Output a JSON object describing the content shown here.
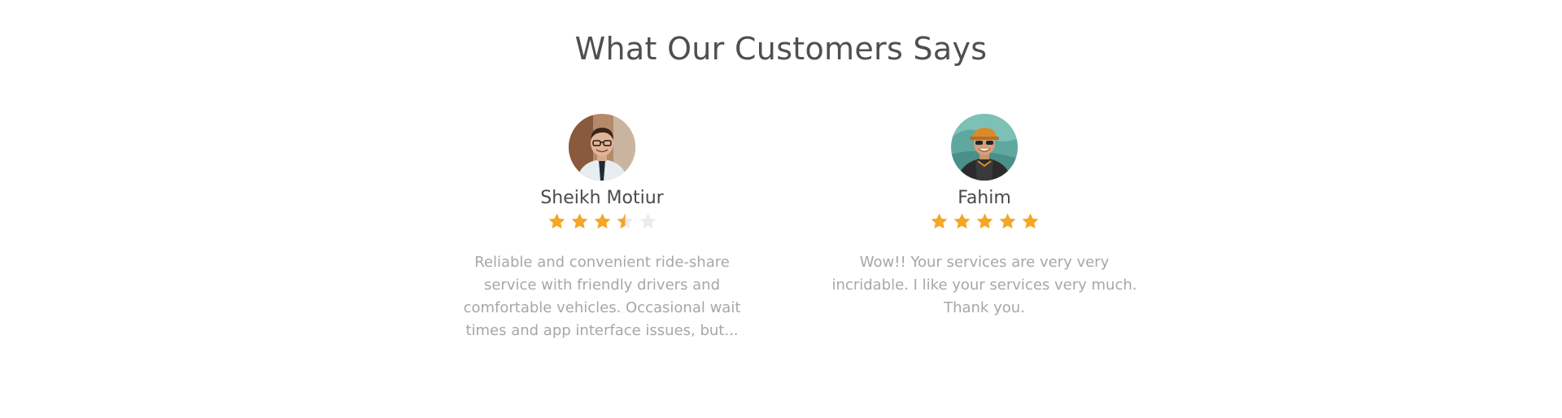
{
  "section": {
    "title": "What Our Customers Says"
  },
  "testimonials": [
    {
      "name": "Sheikh Motiur",
      "rating": 3.5,
      "rating_max": 5,
      "review": "Reliable and convenient ride-share service with friendly drivers and comfortable vehicles. Occasional wait times and app interface issues, but..."
    },
    {
      "name": "Fahim",
      "rating": 5,
      "rating_max": 5,
      "review": "Wow!! Your services are very very incridable. I like your services very much. Thank you."
    }
  ],
  "colors": {
    "title": "#4f4f4f",
    "name": "#4a4a4a",
    "review": "#a7a7a7",
    "star_filled": "#f5a623",
    "star_empty": "#ececec"
  },
  "icons": {
    "star": "star-icon",
    "avatar": "avatar"
  }
}
